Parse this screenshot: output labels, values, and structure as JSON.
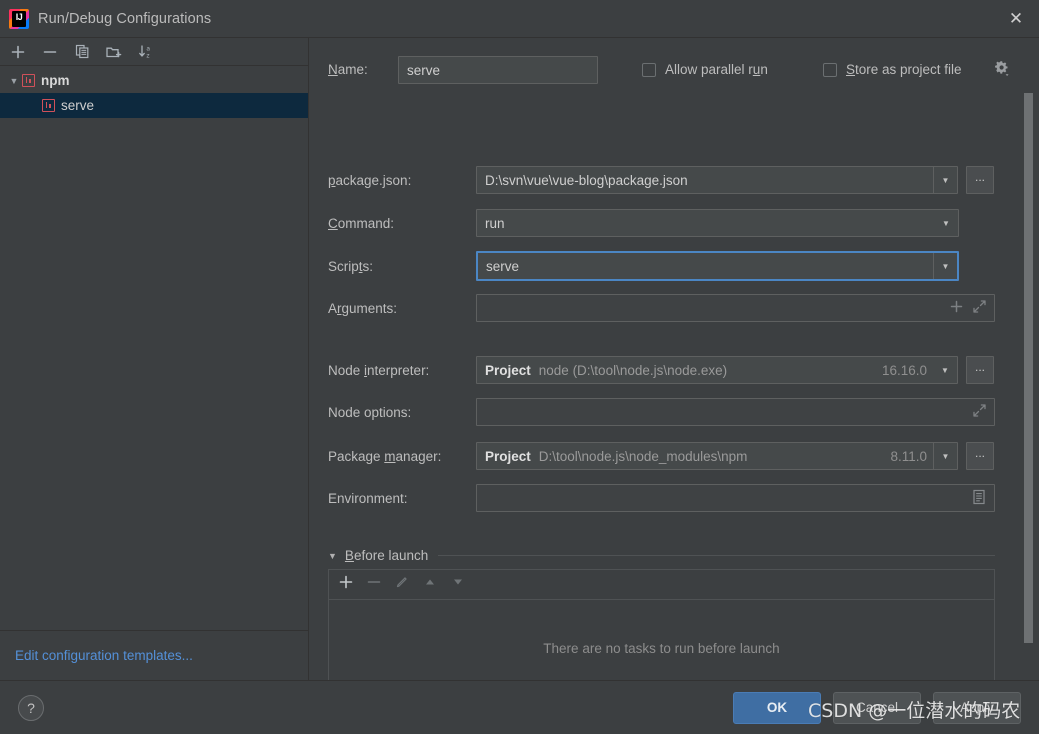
{
  "window": {
    "title": "Run/Debug Configurations",
    "logo_icon": "intellij-idea-logo",
    "logo_text": "IJ",
    "close_icon": "close-icon"
  },
  "left_panel": {
    "toolbar": [
      {
        "icon": "add-icon",
        "label": "+"
      },
      {
        "icon": "remove-icon",
        "label": "−"
      },
      {
        "icon": "copy-icon",
        "label": "copy"
      },
      {
        "icon": "add-folder-icon",
        "label": "folder-add"
      },
      {
        "icon": "sort-alphabetically-icon",
        "label": "sort-az"
      }
    ],
    "tree": [
      {
        "label": "npm",
        "type": "group",
        "expanded": true,
        "icon": "npm-icon",
        "selected": false
      },
      {
        "label": "serve",
        "type": "child",
        "icon": "npm-icon",
        "selected": true
      }
    ],
    "footer_link": "Edit configuration templates..."
  },
  "form": {
    "name": {
      "label": "Name:",
      "mnemonic": "N",
      "value": "serve"
    },
    "allow_parallel_run": {
      "label": "Allow parallel run",
      "mnemonic": "u",
      "checked": false
    },
    "store_as_project_file": {
      "label": "Store as project file",
      "mnemonic": "S",
      "checked": false,
      "gear_icon": "gear-dropdown-icon"
    },
    "package_json": {
      "label": "package.json:",
      "mnemonic": "p",
      "value": "D:\\svn\\vue\\vue-blog\\package.json",
      "dropdown_icon": "chevron-down-icon",
      "browse_label": "..."
    },
    "command": {
      "label": "Command:",
      "mnemonic": "C",
      "value": "run",
      "dropdown_icon": "chevron-down-icon"
    },
    "scripts": {
      "label": "Scripts:",
      "mnemonic": "t",
      "value": "serve",
      "focused": true,
      "dropdown_icon": "chevron-down-icon"
    },
    "arguments": {
      "label": "Arguments:",
      "mnemonic": "r",
      "value": "",
      "placeholder": "",
      "add_icon": "plus-icon",
      "expand_icon": "expand-icon"
    },
    "node_interpreter": {
      "label": "Node interpreter:",
      "mnemonic": "i",
      "scope": "Project",
      "path": "node (D:\\tool\\node.js\\node.exe)",
      "version": "16.16.0",
      "dropdown_icon": "chevron-down-icon",
      "browse_label": "..."
    },
    "node_options": {
      "label": "Node options:",
      "value": "",
      "expand_icon": "expand-icon"
    },
    "package_manager": {
      "label": "Package manager:",
      "mnemonic": "m",
      "scope": "Project",
      "path": "D:\\tool\\node.js\\node_modules\\npm",
      "version": "8.11.0",
      "dropdown_icon": "chevron-down-icon",
      "browse_label": "..."
    },
    "environment": {
      "label": "Environment:",
      "value": "",
      "edit_icon": "environment-variables-icon"
    }
  },
  "before_launch": {
    "title": "Before launch",
    "mnemonic": "B",
    "expanded": true,
    "collapse_icon": "triangle-down-icon",
    "toolbar": [
      {
        "icon": "add-task-icon",
        "label": "+",
        "enabled": true
      },
      {
        "icon": "remove-task-icon",
        "label": "−",
        "enabled": false
      },
      {
        "icon": "edit-task-icon",
        "label": "edit",
        "enabled": false
      },
      {
        "icon": "move-up-icon",
        "label": "up",
        "enabled": false
      },
      {
        "icon": "move-down-icon",
        "label": "down",
        "enabled": false
      }
    ],
    "empty_text": "There are no tasks to run before launch"
  },
  "bottom_bar": {
    "help_icon": "help-icon",
    "help_label": "?",
    "buttons": [
      {
        "label": "OK",
        "style": "primary"
      },
      {
        "label": "Cancel",
        "style": "secondary"
      },
      {
        "label": "Apply",
        "style": "secondary"
      }
    ]
  },
  "watermark": "CSDN @一位潜水的码农",
  "colors": {
    "background": "#3c3f41",
    "field_background": "#45494a",
    "selection": "#0d293e",
    "accent_blue": "#4b86c4",
    "link_blue": "#5490d8",
    "primary_button": "#3f6ea3",
    "npm_icon_red": "#d0515a",
    "text_primary": "#bdbdbd",
    "text_muted": "#8f8f8f"
  }
}
